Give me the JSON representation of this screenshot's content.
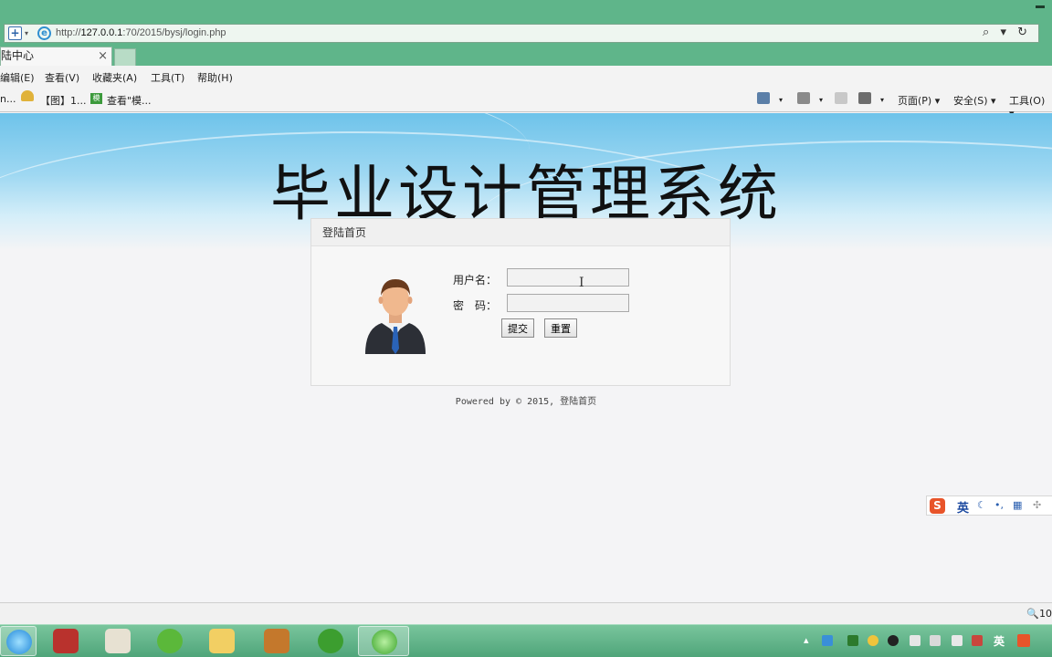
{
  "browser": {
    "url_prefix": "http://",
    "url_host": "127.0.0.1",
    "url_rest": ":70/2015/bysj/login.php",
    "search_glyph": "⌕ ▾ ↻",
    "tab_title": "陆中心",
    "tab_close": "×"
  },
  "menu": {
    "items": [
      "编辑(E)",
      "查看(V)",
      "收藏夹(A)",
      "工具(T)",
      "帮助(H)"
    ]
  },
  "favorites": {
    "items": [
      "n...",
      "【图】1...",
      "查看\"模..."
    ]
  },
  "commandbar": {
    "page": "页面(P) ▾",
    "safety": "安全(S) ▾",
    "tools": "工具(O) ▾"
  },
  "page": {
    "title": "毕业设计管理系统",
    "panel_title": "登陆首页",
    "username_label": "用户名：",
    "password_label": "密　码：",
    "submit_label": "提交",
    "reset_label": "重置",
    "footer": "Powered by © 2015, 登陆首页"
  },
  "ime": {
    "logo": "S",
    "lang": "英"
  },
  "status": {
    "zoom": "🔍10"
  },
  "taskbar": {
    "tray_lang": "英"
  },
  "colors": {
    "chrome": "#5fb58a",
    "taskbar": "#4fa57a",
    "banner": "#6ec3ea"
  }
}
